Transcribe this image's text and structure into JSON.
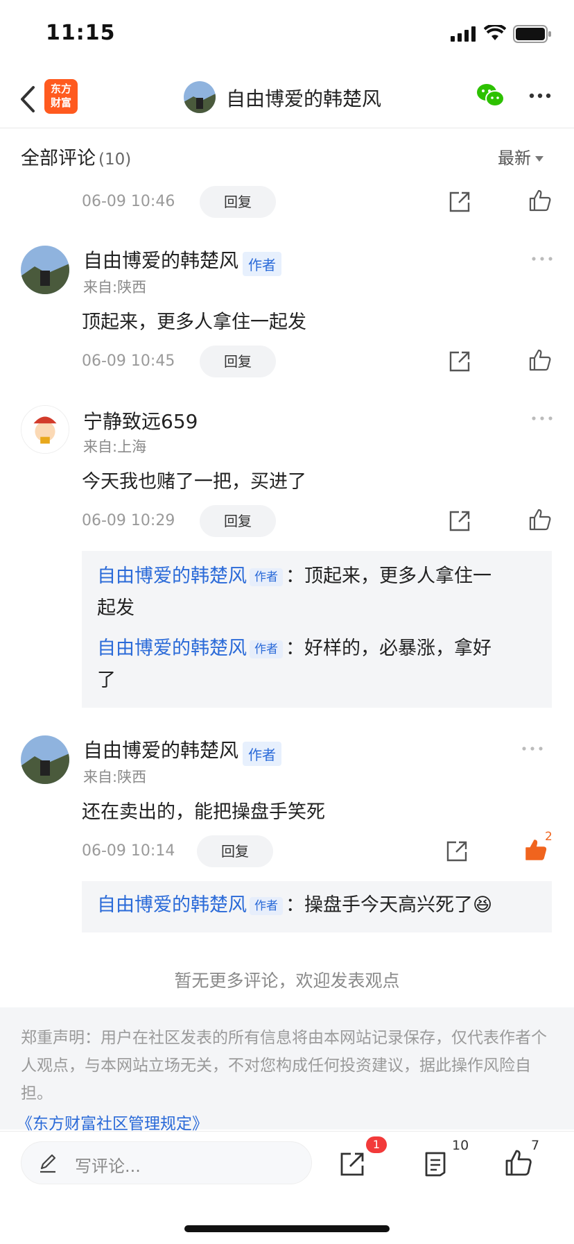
{
  "status_bar": {
    "time": "11:15"
  },
  "nav": {
    "logo_line1": "东方",
    "logo_line2": "财富",
    "title": "自由博爱的韩楚风"
  },
  "header": {
    "title": "全部评论",
    "count": "(10)",
    "sort_label": "最新"
  },
  "common": {
    "reply": "回复",
    "author_badge": "作者"
  },
  "comments": [
    {
      "time": "06-09 10:46"
    },
    {
      "name": "自由博爱的韩楚风",
      "location": "来自:陕西",
      "content": "顶起来，更多人拿住一起发",
      "time": "06-09 10:45"
    },
    {
      "name": "宁静致远659",
      "location": "来自:上海",
      "content": "今天我也赌了一把，买进了",
      "time": "06-09 10:29",
      "replies": [
        {
          "name": "自由博爱的韩楚风",
          "text_line1": "：顶起来，更多人拿住一",
          "text_line2": "起发"
        },
        {
          "name": "自由博爱的韩楚风",
          "text_line1": "：好样的，必暴涨，拿好",
          "text_line2": "了"
        }
      ]
    },
    {
      "name": "自由博爱的韩楚风",
      "location": "来自:陕西",
      "content": "还在卖出的，能把操盘手笑死",
      "time": "06-09 10:14",
      "like_count": "2",
      "replies": [
        {
          "name": "自由博爱的韩楚风",
          "text_line1": "：操盘手今天高兴死了😆"
        }
      ]
    }
  ],
  "no_more": "暂无更多评论，欢迎发表观点",
  "disclaimer": {
    "text": "郑重声明：用户在社区发表的所有信息将由本网站记录保存，仅代表作者个人观点，与本网站立场无关，不对您构成任何投资建议，据此操作风险自担。",
    "link": "《东方财富社区管理规定》"
  },
  "bottom_bar": {
    "input_placeholder": "写评论...",
    "share_badge": "1",
    "comment_count": "10",
    "like_count": "7"
  },
  "colors": {
    "accent": "#2a6ad8",
    "brand": "#ff5a1f",
    "like_active": "#f0641e",
    "badge": "#f23a3a"
  }
}
